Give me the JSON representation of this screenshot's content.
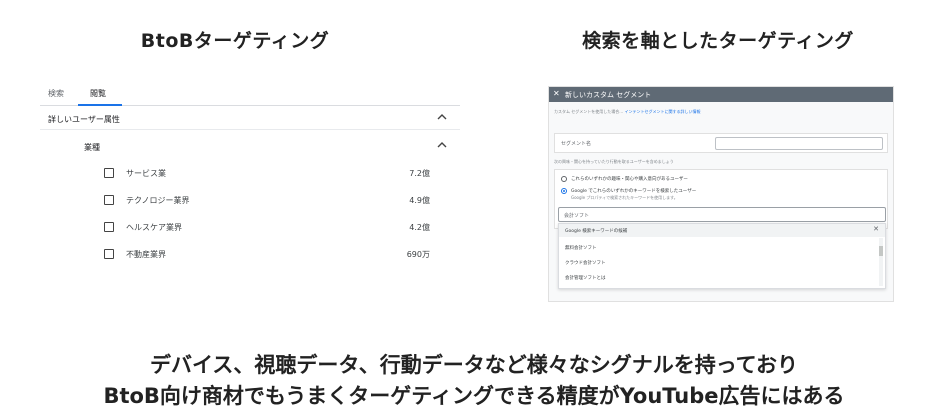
{
  "headings": {
    "left": "BtoBターゲティング",
    "right": "検索を軸としたターゲティング"
  },
  "left_panel": {
    "tabs": [
      "検索",
      "閲覧"
    ],
    "active_tab": "閲覧",
    "section": "詳しいユーザー属性",
    "subsection": "業種",
    "rows": [
      {
        "name": "サービス業",
        "value": "7.2億"
      },
      {
        "name": "テクノロジー業界",
        "value": "4.9億"
      },
      {
        "name": "ヘルスケア業界",
        "value": "4.2億"
      },
      {
        "name": "不動産業界",
        "value": "690万"
      }
    ]
  },
  "right_panel": {
    "title": "新しいカスタム セグメント",
    "intro": "カスタム セグメントを使用した場合…",
    "intro_link": "インテントセグメントに関する詳しい情報",
    "name_label": "セグメント名",
    "question": "次の興味・関心を持っていたり行動を取るユーザーを含めましょう",
    "options": [
      "これらのいずれかの趣味・関心や購入意向があるユーザー",
      "Google でこれらのいずれかのキーワードを検索したユーザー"
    ],
    "option_note": "Google プロパティで検索されたキーワードを使用します。",
    "search_placeholder": "会計ソフト",
    "dropdown_header": "Google 検索キーワードの候補",
    "dropdown_items": [
      "無料会計ソフト",
      "クラウド会計ソフト",
      "会計管理ソフトとは"
    ]
  },
  "bottom": {
    "line1": "デバイス、視聴データ、行動データなど様々なシグナルを持っており",
    "line2": "BtoB向け商材でもうまくターゲティングできる精度がYouTube広告にはある"
  }
}
